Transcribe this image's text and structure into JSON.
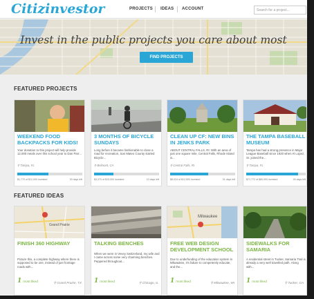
{
  "header": {
    "logo": "Citizinvestor",
    "nav": [
      "PROJECTS",
      "IDEAS",
      "ACCOUNT"
    ],
    "search_placeholder": "Search for a project..."
  },
  "hero": {
    "title": "Invest in the public projects you care about most",
    "button": "FIND PROJECTS"
  },
  "featured_projects": {
    "title": "FEATURED PROJECTS",
    "cards": [
      {
        "title": "WEEKEND FOOD BACKPACKS FOR KIDS!",
        "desc": "Your donation to this project will help provide 12,000 meals over this school year to Dan Parr...",
        "location": "Tampa, FL",
        "progress": 0.48,
        "stats_left": "$1,770 of $12,000 invested",
        "stats_right": "30 days left"
      },
      {
        "title": "3 MONTHS OF BICYCLE SUNDAYS",
        "desc": "Long before it became fashionable to close a road for recreation, San Mateo County started Bicycle...",
        "location": "Belmont, CA",
        "progress": 0.3,
        "stats_left": "$4,370 of $15,000 invested",
        "stats_right": "10 days left"
      },
      {
        "title": "CLEAN UP CF: NEW BINS IN JENKS PARK",
        "desc": "ABOUT CENTRAL FALLS, RI: With an area of just one square mile, Central Falls, Rhode Island is...",
        "location": "Central Falls, RI",
        "progress": 0.58,
        "stats_left": "$8,024 of $12,500 invested",
        "stats_right": "31 days left"
      },
      {
        "title": "THE TAMPA BASEBALL MUSEUM",
        "desc": "Tampa has had a strong presence in Major League Baseball since 1920 when Al Lopez, Sr. joined the...",
        "location": "Tampa, FL",
        "progress": 0.87,
        "stats_left": "$71,772 of $80,000 invested",
        "stats_right": "45 days left"
      }
    ]
  },
  "featured_ideas": {
    "title": "FEATURED IDEAS",
    "cards": [
      {
        "title": "FINISH 360 HIGHWAY",
        "desc": "Picture this, a complete highway where there is supposed to be one, instead of just frontage roads with...",
        "liked_count": "1",
        "liked_label": "most liked",
        "location": "Grand Prairie, TX",
        "map_label": "Grand Prairie"
      },
      {
        "title": "TALKING BENCHES",
        "desc": "When we were in Vevey Switzerland, my wife and I came across some very charming benches. Peppered throughout...",
        "liked_count": "1",
        "liked_label": "most liked",
        "location": "Chicago, IL"
      },
      {
        "title": "FREE WEB DESIGN DEVELOPMENT SCHOOL",
        "desc": "Due to underfunding of the education system in Milwaukee, it's failure to competently educate, and the...",
        "liked_count": "1",
        "liked_label": "most liked",
        "location": "Milwaukee, WI",
        "map_label": "Milwaukee"
      },
      {
        "title": "SIDEWALKS FOR SAMARIA",
        "desc": "A residential street in Tucker, Samaria Trail is already a very well travelled path. Along with...",
        "liked_count": "1",
        "liked_label": "most liked",
        "location": "Tucker, GA"
      }
    ]
  },
  "colors": {
    "accent_blue": "#2aa6d6",
    "accent_green": "#7ab542"
  }
}
